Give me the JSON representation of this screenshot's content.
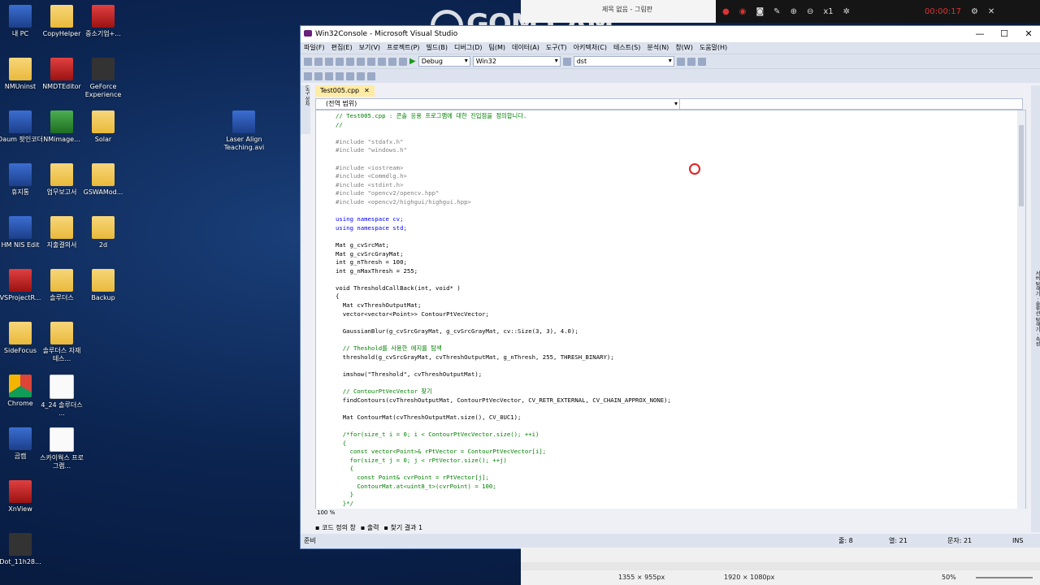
{
  "desktop": {
    "icons": [
      {
        "label": "내 PC"
      },
      {
        "label": "CopyHelper"
      },
      {
        "label": "중소기업+..."
      },
      {
        "label": "NMUninst"
      },
      {
        "label": "NMDTEditor"
      },
      {
        "label": "GeForce Experience"
      },
      {
        "label": "Daum 팟인코더"
      },
      {
        "label": "NMimage..."
      },
      {
        "label": "Solar"
      },
      {
        "label": "휴지통"
      },
      {
        "label": "업무보고서"
      },
      {
        "label": "GSWAMod..."
      },
      {
        "label": "HM NIS Edit"
      },
      {
        "label": "지출결의서"
      },
      {
        "label": "2d"
      },
      {
        "label": "VSProjectR..."
      },
      {
        "label": "솔루더스"
      },
      {
        "label": "Backup"
      },
      {
        "label": "SideFocus"
      },
      {
        "label": "솔루더스 자재 테스..."
      },
      {
        "label": "Chrome"
      },
      {
        "label": "4_24 솔루더스 ..."
      },
      {
        "label": "곰캠"
      },
      {
        "label": "스카이웍스 프로그램..."
      },
      {
        "label": "XnView"
      },
      {
        "label": "Dot_11h28..."
      },
      {
        "label": "Laser Align Teaching.avi"
      }
    ]
  },
  "vs": {
    "title": "Win32Console - Microsoft Visual Studio",
    "window_buttons": {
      "min": "—",
      "max": "☐",
      "close": "✕"
    },
    "menu": [
      "파일(F)",
      "편집(E)",
      "보기(V)",
      "프로젝트(P)",
      "빌드(B)",
      "디버그(D)",
      "팀(M)",
      "데이터(A)",
      "도구(T)",
      "아키텍처(C)",
      "테스트(S)",
      "분석(N)",
      "창(W)",
      "도움말(H)"
    ],
    "config": "Debug",
    "platform": "Win32",
    "find": "dst",
    "tab": {
      "label": "Test005.cpp",
      "close": "✕"
    },
    "scope": "(전역 범위)",
    "zoom": "100 %",
    "lower_tabs": [
      "코드 정의 창",
      "출력",
      "찾기 결과 1"
    ],
    "status": {
      "ready": "준비",
      "line": "줄: 8",
      "col": "열: 21",
      "char": "문자: 21",
      "mode": "INS"
    },
    "right_strip": "서버 탐색기 · 솔루션 탐색기 · 속성",
    "left_strip": "도구 상자"
  },
  "code_lines": [
    {
      "t": "// Test005.cpp : 콘솔 응용 프로그램에 대한 진입점을 정의합니다.",
      "c": "cm"
    },
    {
      "t": "//",
      "c": "cm"
    },
    {
      "t": "",
      "c": ""
    },
    {
      "t": "#include \"stdafx.h\"",
      "c": "pp"
    },
    {
      "t": "#include \"windows.h\"",
      "c": "pp"
    },
    {
      "t": "",
      "c": ""
    },
    {
      "t": "#include <iostream>",
      "c": "pp"
    },
    {
      "t": "#include <Commdlg.h>",
      "c": "pp"
    },
    {
      "t": "#include <stdint.h>",
      "c": "pp"
    },
    {
      "t": "#include \"opencv2/opencv.hpp\"",
      "c": "pp"
    },
    {
      "t": "#include <opencv2/highgui/highgui.hpp>",
      "c": "pp"
    },
    {
      "t": "",
      "c": ""
    },
    {
      "t": "using namespace cv;",
      "c": "kw"
    },
    {
      "t": "using namespace std;",
      "c": "kw"
    },
    {
      "t": "",
      "c": ""
    },
    {
      "t": "Mat g_cvSrcMat;",
      "c": ""
    },
    {
      "t": "Mat g_cvSrcGrayMat;",
      "c": ""
    },
    {
      "t": "int g_nThresh = 100;",
      "c": ""
    },
    {
      "t": "int g_nMaxThresh = 255;",
      "c": ""
    },
    {
      "t": "",
      "c": ""
    },
    {
      "t": "void ThresholdCallBack(int, void* )",
      "c": ""
    },
    {
      "t": "{",
      "c": ""
    },
    {
      "t": "  Mat cvThreshOutputMat;",
      "c": ""
    },
    {
      "t": "  vector<vector<Point>> ContourPtVecVector;",
      "c": ""
    },
    {
      "t": "",
      "c": ""
    },
    {
      "t": "  GaussianBlur(g_cvSrcGrayMat, g_cvSrcGrayMat, cv::Size(3, 3), 4.0);",
      "c": ""
    },
    {
      "t": "",
      "c": ""
    },
    {
      "t": "  // Theshold를 사용한 에지를 탐색",
      "c": "cm"
    },
    {
      "t": "  threshold(g_cvSrcGrayMat, cvThreshOutputMat, g_nThresh, 255, THRESH_BINARY);",
      "c": ""
    },
    {
      "t": "",
      "c": ""
    },
    {
      "t": "  imshow(\"Threshold\", cvThreshOutputMat);",
      "c": ""
    },
    {
      "t": "",
      "c": ""
    },
    {
      "t": "  // ContourPtVecVector 찾기",
      "c": "cm"
    },
    {
      "t": "  findContours(cvThreshOutputMat, ContourPtVecVector, CV_RETR_EXTERNAL, CV_CHAIN_APPROX_NONE);",
      "c": ""
    },
    {
      "t": "",
      "c": ""
    },
    {
      "t": "  Mat ContourMat(cvThreshOutputMat.size(), CV_8UC1);",
      "c": ""
    },
    {
      "t": "",
      "c": ""
    },
    {
      "t": "  /*for(size_t i = 0; i < ContourPtVecVector.size(); ++i)",
      "c": "cm"
    },
    {
      "t": "  {",
      "c": "cm"
    },
    {
      "t": "    const vector<Point>& rPtVector = ContourPtVecVector[i];",
      "c": "cm"
    },
    {
      "t": "    for(size_t j = 0; j < rPtVector.size(); ++j)",
      "c": "cm"
    },
    {
      "t": "    {",
      "c": "cm"
    },
    {
      "t": "      const Point& cvrPoint = rPtVector[j];",
      "c": "cm"
    },
    {
      "t": "      ContourMat.at<uint8_t>(cvrPoint) = 100;",
      "c": "cm"
    },
    {
      "t": "    }",
      "c": "cm"
    },
    {
      "t": "  }*/",
      "c": "cm"
    }
  ],
  "paint": {
    "title": "제목 없음 - 그림판",
    "size1": "1355 × 955px",
    "size2": "1920 × 1080px",
    "zoom": "50%"
  },
  "gomcam": {
    "logo": "GOM CAM",
    "timer": "00:00:17",
    "zoom": "x1"
  }
}
